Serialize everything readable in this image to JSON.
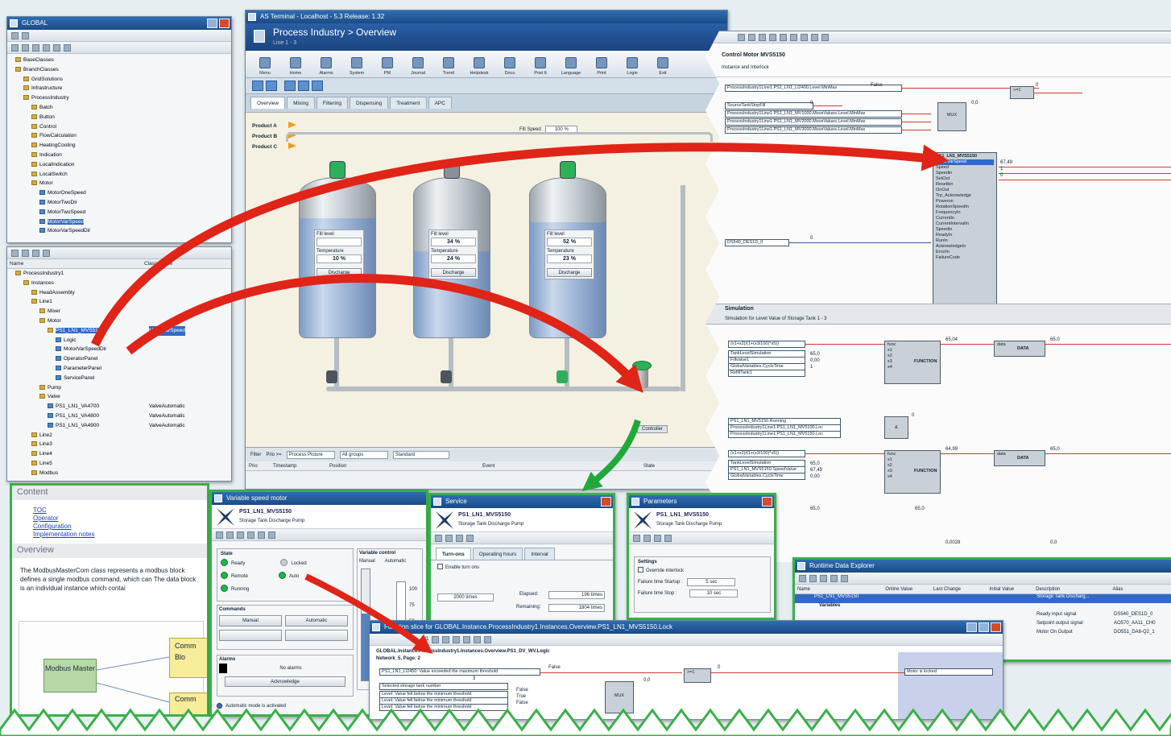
{
  "global_tree": {
    "title": "GLOBAL",
    "items": [
      "BaseClasses",
      "BranchClasses",
      "GridSolutions",
      "Infrastructure",
      "ProcessIndustry",
      "Batch",
      "Button",
      "Control",
      "FlowCalculation",
      "HeatingCooling",
      "Indication",
      "LocalIndication",
      "LocalSwitch",
      "Motor",
      "MotorOneSpeed",
      "MotorTwoDir",
      "MotorTwoSpeed",
      "MotorVarSpeed",
      "MotorVarSpeedDir"
    ],
    "selected": "MotorVarSpeed"
  },
  "instance_tree": {
    "col_name": "Name",
    "col_class": "Class Name",
    "items": [
      "ProcessIndustry1",
      "Instances",
      "HeadAssembly",
      "Line1",
      "Mixer",
      "Motor",
      "PS1_LN1_MVS5150",
      "Logic",
      "MotorVarSpeedDir",
      "OperatorPanel",
      "ParameterPanel",
      "ServicePanel",
      "Pump",
      "Valve",
      "PS1_LN1_VA4700",
      "PS1_LN1_VA4800",
      "PS1_LN1_VA4900",
      "Line2",
      "Line3",
      "Line4",
      "Line5",
      "Modbus"
    ],
    "selected_class": "MotorVarSpeed",
    "valve_class": "ValveAutomatic"
  },
  "hmi": {
    "window_title": "AS Terminal - Localhost - 5.3 Release: 1.32",
    "header_title": "Process Industry > Overview",
    "header_sub": "Line 1 - 3",
    "nav": [
      "Menu",
      "Home",
      "Alarms",
      "System",
      "PM",
      "Journal",
      "Trend",
      "Helpdesk",
      "Docu",
      "Post It",
      "Language",
      "Print",
      "Login",
      "Exit"
    ],
    "tabs": [
      "Overview",
      "Mixing",
      "Filtering",
      "Dispensing",
      "Treatment",
      "APC"
    ],
    "products": [
      "Product A",
      "Product B",
      "Product C"
    ],
    "fill_speed_label": "Fill Speed",
    "fill_speed_value": "100 %",
    "fill_level": "Fill level",
    "temperature": "Temperature",
    "discharge": "Discharge",
    "tanks": [
      {
        "fill": "",
        "temp": "10 %",
        "level_pct": 55,
        "cap": "green"
      },
      {
        "fill": "34 %",
        "temp": "24 %",
        "level_pct": 34,
        "cap": "grey"
      },
      {
        "fill": "52 %",
        "temp": "23 %",
        "level_pct": 52,
        "cap": "green"
      }
    ],
    "controller_label": "Controller",
    "status": {
      "filter": "Filter",
      "prio": "Prio",
      "timestamp": "Timestamp",
      "position": "Position",
      "event": "Event",
      "state": "State",
      "process_picture": "Process Picture",
      "all_groups": "All groups",
      "standard": "Standard",
      "prio_value": "Prio >="
    }
  },
  "logic": {
    "title": "Control Motor MVS5150",
    "subtitle": "Instance and Interlock",
    "signals_top": [
      "ProcessIndustry1Line1.PS1_LN1_LI2400.Level.MinMax",
      "SourceTankStopFill",
      "ProcessIndustry1Line1.PS1_LN1_MV1000.MoveValues.Level.MinMax",
      "ProcessIndustry1Line1.PS1_LN1_MV2000.MoveValues.Level.MinMax",
      "ProcessIndustry1Line1.PS1_LN1_MV3000.MoveValues.Level.MinMax"
    ],
    "false": "False",
    "zero": "0",
    "or_block": ">=1",
    "sel_val": "0,0",
    "mux": "MUX",
    "mux_pins": [
      "sel",
      "in1",
      "in2",
      "in3"
    ],
    "fb_name": "PS1_LN1_MVS5150",
    "fb_class": "MotorVarSpeed",
    "fb_pins": [
      "Speed",
      "Speedin",
      "SetOut",
      "Resetkin",
      "OnOut",
      "Trp_Acknowledge",
      "Poweron",
      "RotationSpeedIn",
      "FrequencyIn",
      "CurrentIn",
      "CurrentIntervalIn",
      "SpeedIn",
      "ReadyIn",
      "RunIn",
      "AcknowledgeIn",
      "ErrorIn",
      "FailureCode"
    ],
    "fb_out_values": [
      "67,49",
      "1",
      "0"
    ],
    "ds_input": "DS540_DES1D_0",
    "sim_title": "Simulation",
    "sim_sub": "Simulation for Level Value of Storage Tank 1 - 3",
    "expr": "(x1+x2)/(1+(x3/100)*x5))",
    "sim_inputs": [
      "TankLevelSimulation",
      "Fillvalue1",
      "GlobalVariables.CycleTime",
      "RefillTank1"
    ],
    "sim_inputs2": [
      "PS1_LN1_MV5150.Running",
      "ProcessIndustry1Line1.PS1_LN1_MV5100.Loc",
      "ProcessIndustry1Line1.PS1_LN1_MV5150.Loc"
    ],
    "sim_inputs3": [
      "TankLevelSimulation",
      "PS1_LN1_MVS5150.SpeedValue",
      "GlobalVariables.CycleTime"
    ],
    "sim_vals": [
      "65,0",
      "0,00",
      "1"
    ],
    "sim_vals3": [
      "65,0",
      "67,49",
      "0,00"
    ],
    "func": "FUNCTION",
    "data": "DATA",
    "out1": "65,04",
    "out2": "65,0",
    "out3": "64,99",
    "out4": "65,0",
    "out5": "0,0028",
    "out6": "0,0",
    "and_block": "&",
    "cmp_val": "65,0",
    "func_pins": [
      "func",
      "x1",
      "x2",
      "x3",
      "x4"
    ],
    "data_pins": [
      "data",
      "in"
    ]
  },
  "content_panel": {
    "heading": "Content",
    "links": [
      "TOC",
      "Operator",
      "Configuration",
      "Implementation notes"
    ],
    "overview": "Overview",
    "text": "The ModbusMasterCom class represents a modbus block defines a single modbus command, which can The data block is an individual instance which contai",
    "modbus_master": "Modbus Master",
    "comm": "Comm",
    "blo": "Blo",
    "comm2": "Comm"
  },
  "vsm": {
    "title": "Variable speed motor",
    "tag": "PS1_LN1_MVS5150",
    "desc": "Storage Tank Discharge Pump",
    "state": "State",
    "ready": "Ready",
    "remote": "Remote",
    "running": "Running",
    "locked": "Locked",
    "auto": "Auto",
    "variable_control": "Variable control",
    "manual_col": "Manual",
    "automatic_col": "Automatic",
    "scale": [
      "100",
      "75",
      "50"
    ],
    "commands": "Commands",
    "manual_btn": "Manual",
    "automatic_btn": "Automatic",
    "alarms": "Alarms",
    "no_alarms": "No alarms",
    "acknowledge": "Acknowledge",
    "footer": "Automatic mode is activated"
  },
  "service": {
    "title": "Service",
    "tag": "PS1_LN1_MVS5150",
    "desc": "Storage Tank Discharge Pump",
    "tabs": [
      "Turn-ons",
      "Operating hours",
      "Interval"
    ],
    "enable": "Enable turn ons",
    "interval": "2000 times",
    "elapsed": "Elapsed:",
    "elapsed_val": "196 times",
    "remaining": "Remaining:",
    "remaining_val": "1804 times"
  },
  "params": {
    "title": "Parameters",
    "tag": "PS1_LN1_MVS5150",
    "desc": "Storage Tank Discharge Pump",
    "settings": "Settings",
    "override": "Override interlock",
    "startup": "Failure time Startup :",
    "startup_val": "5 sec",
    "stop": "Failure time Stop :",
    "stop_val": "10 sec"
  },
  "rde": {
    "title": "Runtime Data Explorer",
    "cols": [
      "Name",
      "Online Value",
      "Last Change",
      "Initial Value",
      "Description",
      "Alias"
    ],
    "row_name": "PS1_LN1_MVS5150",
    "row_desc": "Storage Tank Discharg...",
    "variables": "Variables",
    "items": [
      {
        "desc": "Ready input signal",
        "alias": "DS540_DES1D_0"
      },
      {
        "desc": "Setpoint output signal",
        "alias": "AO570_AA11_CH0"
      },
      {
        "desc": "Motor On Output",
        "alias": "DO551_DA8-Q2_1"
      }
    ]
  },
  "editor": {
    "title": "Function slice for GLOBAL.Instance.ProcessIndustry1.Instances.Overview.PS1_LN1_MVS5150.Lock",
    "page": "1/1",
    "header": "GLOBAL.Instance.ProcessIndustry1.Instances.Overview.PS1_DV_WV.Logic",
    "network": "Network_5, Page: 2",
    "sig1": "PS1_LN1_LI2450: Value exceeded the maximum threshold",
    "sig2": "Selected storage tank number",
    "sig3": "Level: Value fell below the minimum threshold",
    "sig4": "Level: Value fell below the minimum threshold",
    "sig5": "Level: Value fell below the minimum threshold",
    "false": "False",
    "true": "True",
    "or_block": ">=1",
    "mux": "MUX",
    "zero": "0",
    "three": "3",
    "val": "0,0",
    "lock_out": "Motor is locked"
  },
  "colors": {
    "arrow_red": "#e02418",
    "arrow_green": "#22a83a",
    "frame_green": "#3ab04a",
    "title_blue": "#1f5595"
  }
}
